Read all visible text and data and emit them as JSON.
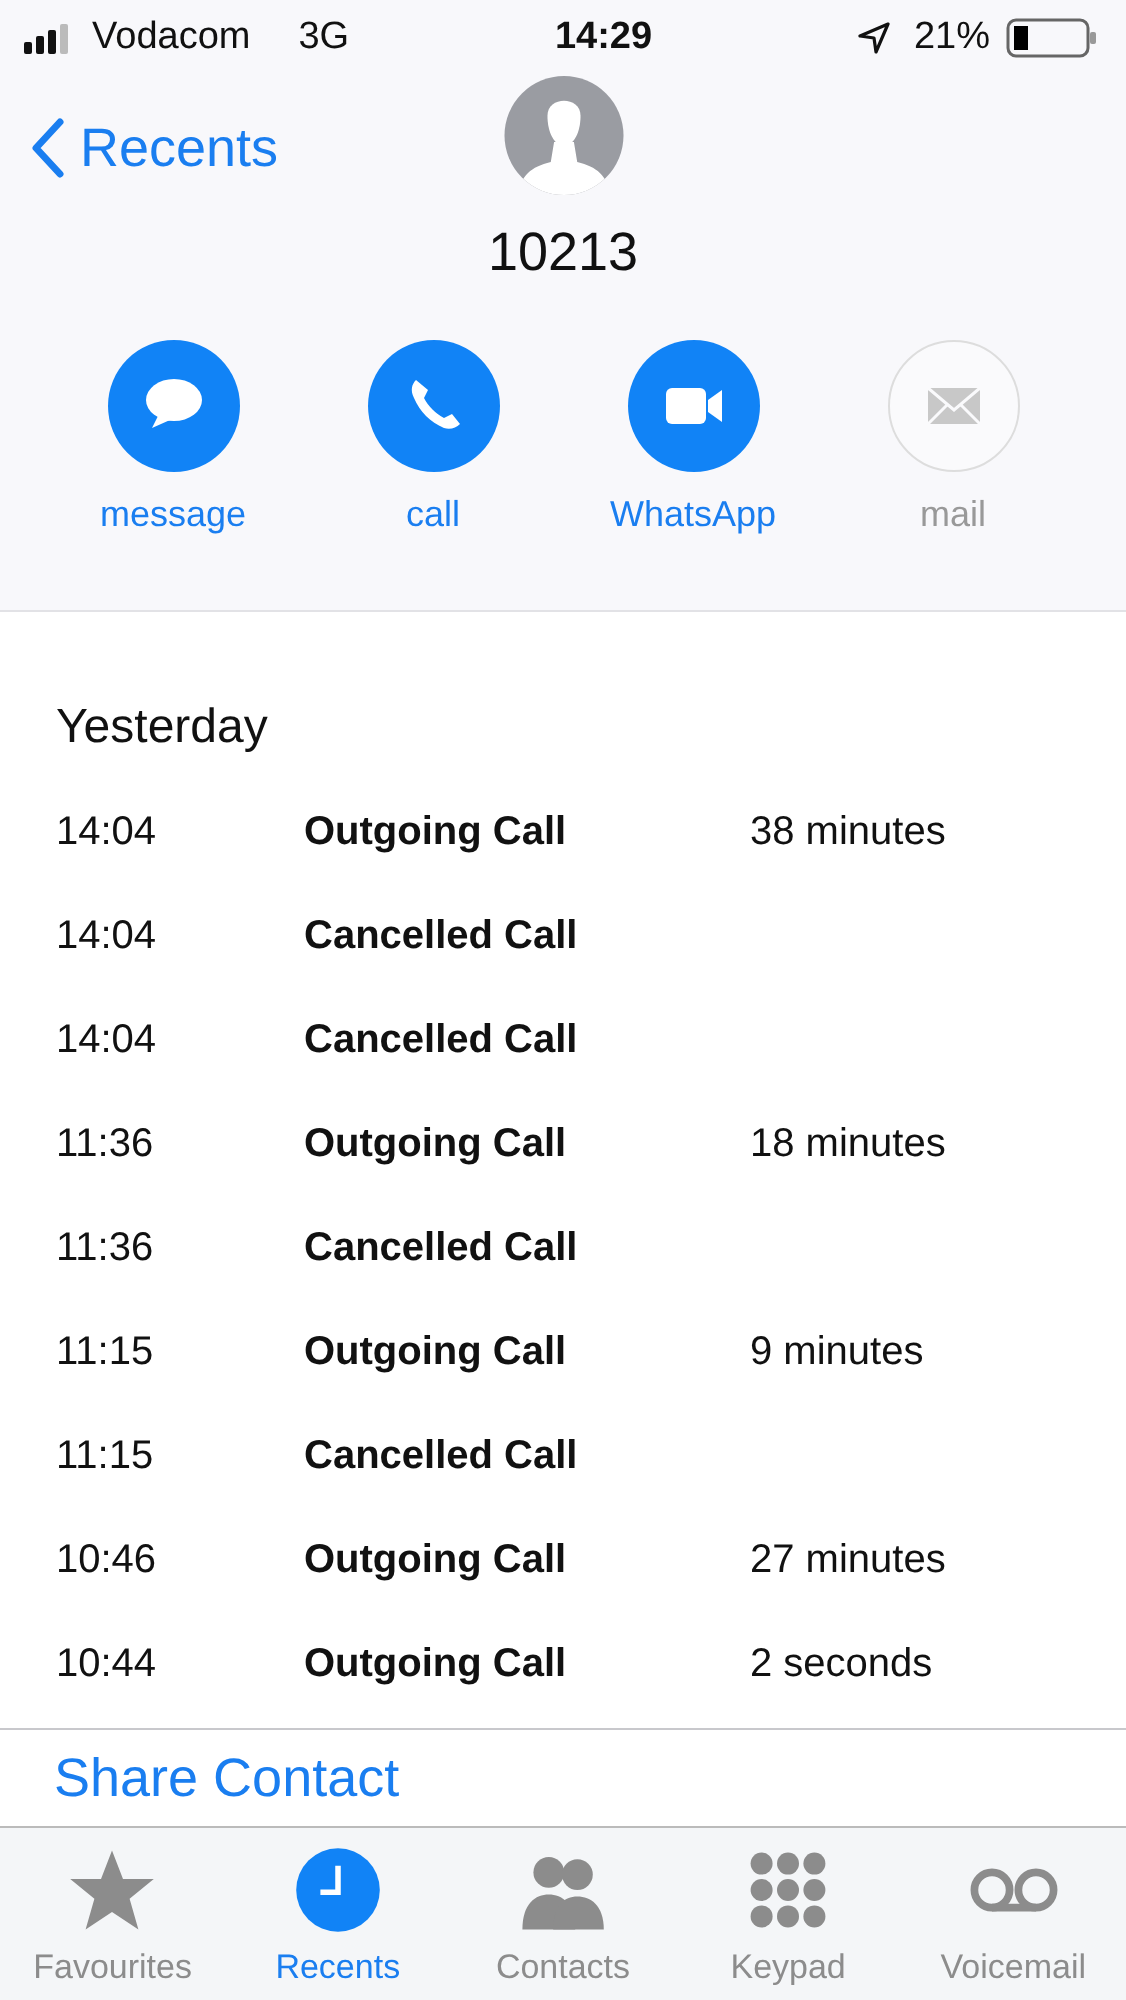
{
  "status_bar": {
    "carrier": "Vodacom",
    "network": "3G",
    "time": "14:29",
    "battery": "21%"
  },
  "nav": {
    "back": "Recents"
  },
  "contact": {
    "name": "10213"
  },
  "actions": [
    {
      "kind": "message",
      "label": "message",
      "disabled": false
    },
    {
      "kind": "call",
      "label": "call",
      "disabled": false
    },
    {
      "kind": "video",
      "label": "WhatsApp",
      "disabled": false
    },
    {
      "kind": "mail",
      "label": "mail",
      "disabled": true
    }
  ],
  "history": {
    "heading": "Yesterday",
    "rows": [
      {
        "time": "14:04",
        "type": "Outgoing Call",
        "duration": "38 minutes"
      },
      {
        "time": "14:04",
        "type": "Cancelled Call"
      },
      {
        "time": "14:04",
        "type": "Cancelled Call"
      },
      {
        "time": "11:36",
        "type": "Outgoing Call",
        "duration": "18 minutes"
      },
      {
        "time": "11:36",
        "type": "Cancelled Call"
      },
      {
        "time": "11:15",
        "type": "Outgoing Call",
        "duration": "9 minutes"
      },
      {
        "time": "11:15",
        "type": "Cancelled Call"
      },
      {
        "time": "10:46",
        "type": "Outgoing Call",
        "duration": "27 minutes"
      },
      {
        "time": "10:44",
        "type": "Outgoing Call",
        "duration": "2 seconds"
      }
    ]
  },
  "share_contact": "Share Contact",
  "tab_bar": [
    {
      "kind": "star",
      "label": "Favourites",
      "selected": false
    },
    {
      "kind": "clock",
      "label": "Recents",
      "selected": true
    },
    {
      "kind": "contacts",
      "label": "Contacts",
      "selected": false
    },
    {
      "kind": "keypad",
      "label": "Keypad",
      "selected": false
    },
    {
      "kind": "voicemail",
      "label": "Voicemail",
      "selected": false
    }
  ]
}
